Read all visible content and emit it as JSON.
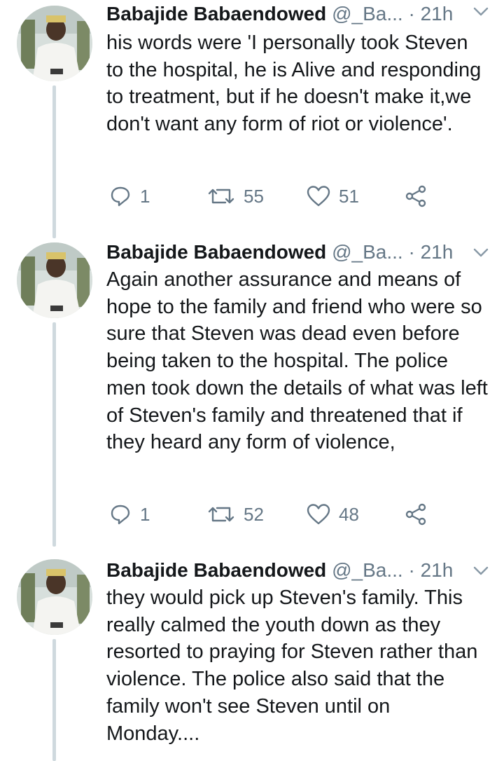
{
  "tweets": [
    {
      "name": "Babajide Babaendowed",
      "handle": "@_Ba...",
      "dot": "·",
      "time": "21h",
      "text": "his words were 'I personally took Steven to the hospital, he is Alive and responding to treatment, but if he doesn't make it,we don't want any form of riot or violence'.",
      "replies": "1",
      "retweets": "55",
      "likes": "51"
    },
    {
      "name": "Babajide Babaendowed",
      "handle": "@_Ba...",
      "dot": "·",
      "time": "21h",
      "text": "Again another assurance and means of hope to the family and friend who were so sure that Steven was dead even before being taken to the hospital. The police men took down the details of what was left of Steven's family and threatened that if they heard any form of violence,",
      "replies": "1",
      "retweets": "52",
      "likes": "48"
    },
    {
      "name": "Babajide Babaendowed",
      "handle": "@_Ba...",
      "dot": "·",
      "time": "21h",
      "text": "they would pick up Steven's family. This really calmed the youth down as they resorted to praying for Steven rather than violence. The police also said that the family won't see Steven until on Monday...."
    }
  ],
  "icons": {
    "reply": "reply-icon",
    "retweet": "retweet-icon",
    "like": "heart-icon",
    "share": "share-icon",
    "menu": "chevron-down-icon"
  },
  "colors": {
    "text": "#14171a",
    "muted": "#657786",
    "thread_line": "#cfd9de"
  }
}
